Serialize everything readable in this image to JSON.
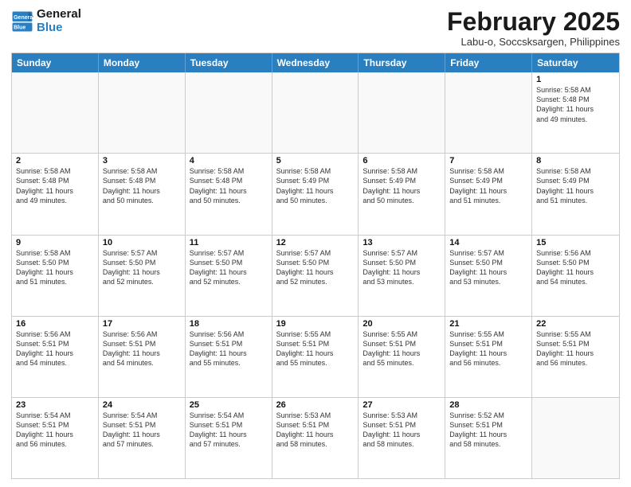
{
  "logo": {
    "line1": "General",
    "line2": "Blue"
  },
  "title": "February 2025",
  "subtitle": "Labu-o, Soccsksargen, Philippines",
  "days_header": [
    "Sunday",
    "Monday",
    "Tuesday",
    "Wednesday",
    "Thursday",
    "Friday",
    "Saturday"
  ],
  "weeks": [
    [
      {
        "day": "",
        "info": ""
      },
      {
        "day": "",
        "info": ""
      },
      {
        "day": "",
        "info": ""
      },
      {
        "day": "",
        "info": ""
      },
      {
        "day": "",
        "info": ""
      },
      {
        "day": "",
        "info": ""
      },
      {
        "day": "1",
        "info": "Sunrise: 5:58 AM\nSunset: 5:48 PM\nDaylight: 11 hours\nand 49 minutes."
      }
    ],
    [
      {
        "day": "2",
        "info": "Sunrise: 5:58 AM\nSunset: 5:48 PM\nDaylight: 11 hours\nand 49 minutes."
      },
      {
        "day": "3",
        "info": "Sunrise: 5:58 AM\nSunset: 5:48 PM\nDaylight: 11 hours\nand 50 minutes."
      },
      {
        "day": "4",
        "info": "Sunrise: 5:58 AM\nSunset: 5:48 PM\nDaylight: 11 hours\nand 50 minutes."
      },
      {
        "day": "5",
        "info": "Sunrise: 5:58 AM\nSunset: 5:49 PM\nDaylight: 11 hours\nand 50 minutes."
      },
      {
        "day": "6",
        "info": "Sunrise: 5:58 AM\nSunset: 5:49 PM\nDaylight: 11 hours\nand 50 minutes."
      },
      {
        "day": "7",
        "info": "Sunrise: 5:58 AM\nSunset: 5:49 PM\nDaylight: 11 hours\nand 51 minutes."
      },
      {
        "day": "8",
        "info": "Sunrise: 5:58 AM\nSunset: 5:49 PM\nDaylight: 11 hours\nand 51 minutes."
      }
    ],
    [
      {
        "day": "9",
        "info": "Sunrise: 5:58 AM\nSunset: 5:50 PM\nDaylight: 11 hours\nand 51 minutes."
      },
      {
        "day": "10",
        "info": "Sunrise: 5:57 AM\nSunset: 5:50 PM\nDaylight: 11 hours\nand 52 minutes."
      },
      {
        "day": "11",
        "info": "Sunrise: 5:57 AM\nSunset: 5:50 PM\nDaylight: 11 hours\nand 52 minutes."
      },
      {
        "day": "12",
        "info": "Sunrise: 5:57 AM\nSunset: 5:50 PM\nDaylight: 11 hours\nand 52 minutes."
      },
      {
        "day": "13",
        "info": "Sunrise: 5:57 AM\nSunset: 5:50 PM\nDaylight: 11 hours\nand 53 minutes."
      },
      {
        "day": "14",
        "info": "Sunrise: 5:57 AM\nSunset: 5:50 PM\nDaylight: 11 hours\nand 53 minutes."
      },
      {
        "day": "15",
        "info": "Sunrise: 5:56 AM\nSunset: 5:50 PM\nDaylight: 11 hours\nand 54 minutes."
      }
    ],
    [
      {
        "day": "16",
        "info": "Sunrise: 5:56 AM\nSunset: 5:51 PM\nDaylight: 11 hours\nand 54 minutes."
      },
      {
        "day": "17",
        "info": "Sunrise: 5:56 AM\nSunset: 5:51 PM\nDaylight: 11 hours\nand 54 minutes."
      },
      {
        "day": "18",
        "info": "Sunrise: 5:56 AM\nSunset: 5:51 PM\nDaylight: 11 hours\nand 55 minutes."
      },
      {
        "day": "19",
        "info": "Sunrise: 5:55 AM\nSunset: 5:51 PM\nDaylight: 11 hours\nand 55 minutes."
      },
      {
        "day": "20",
        "info": "Sunrise: 5:55 AM\nSunset: 5:51 PM\nDaylight: 11 hours\nand 55 minutes."
      },
      {
        "day": "21",
        "info": "Sunrise: 5:55 AM\nSunset: 5:51 PM\nDaylight: 11 hours\nand 56 minutes."
      },
      {
        "day": "22",
        "info": "Sunrise: 5:55 AM\nSunset: 5:51 PM\nDaylight: 11 hours\nand 56 minutes."
      }
    ],
    [
      {
        "day": "23",
        "info": "Sunrise: 5:54 AM\nSunset: 5:51 PM\nDaylight: 11 hours\nand 56 minutes."
      },
      {
        "day": "24",
        "info": "Sunrise: 5:54 AM\nSunset: 5:51 PM\nDaylight: 11 hours\nand 57 minutes."
      },
      {
        "day": "25",
        "info": "Sunrise: 5:54 AM\nSunset: 5:51 PM\nDaylight: 11 hours\nand 57 minutes."
      },
      {
        "day": "26",
        "info": "Sunrise: 5:53 AM\nSunset: 5:51 PM\nDaylight: 11 hours\nand 58 minutes."
      },
      {
        "day": "27",
        "info": "Sunrise: 5:53 AM\nSunset: 5:51 PM\nDaylight: 11 hours\nand 58 minutes."
      },
      {
        "day": "28",
        "info": "Sunrise: 5:52 AM\nSunset: 5:51 PM\nDaylight: 11 hours\nand 58 minutes."
      },
      {
        "day": "",
        "info": ""
      }
    ]
  ]
}
